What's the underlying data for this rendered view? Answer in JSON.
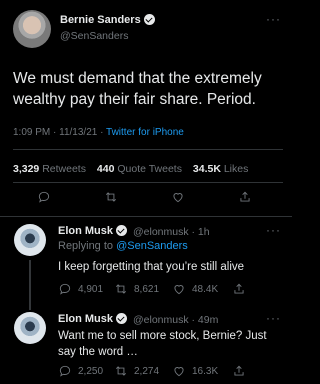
{
  "main": {
    "name": "Bernie Sanders",
    "handle": "@SenSanders",
    "text": "We must demand that the extremely wealthy pay their fair share. Period.",
    "time": "1:09 PM · 11/13/21 · ",
    "source": "Twitter for iPhone",
    "retweets_count": "3,329",
    "retweets_label": "Retweets",
    "quotes_count": "440",
    "quotes_label": "Quote Tweets",
    "likes_count": "34.5K",
    "likes_label": "Likes",
    "more": "···"
  },
  "replies": [
    {
      "name": "Elon Musk",
      "handle": "@elonmusk · 1h",
      "replying_prefix": "Replying to ",
      "replying_to": "@SenSanders",
      "text": "I keep forgetting that you’re still alive",
      "replies": "4,901",
      "retweets": "8,621",
      "likes": "48.4K"
    },
    {
      "name": "Elon Musk",
      "handle": "@elonmusk · 49m",
      "text": "Want me to sell more stock, Bernie? Just say the word …",
      "replies": "2,250",
      "retweets": "2,274",
      "likes": "16.3K"
    }
  ],
  "colors": {
    "background": "#000000",
    "text": "#e7e9ea",
    "muted": "#71767b",
    "link": "#1d9bf0",
    "divider": "#2f3336"
  },
  "icons": [
    "verified-badge-icon",
    "reply-icon",
    "retweet-icon",
    "like-icon",
    "share-icon",
    "more-icon"
  ]
}
